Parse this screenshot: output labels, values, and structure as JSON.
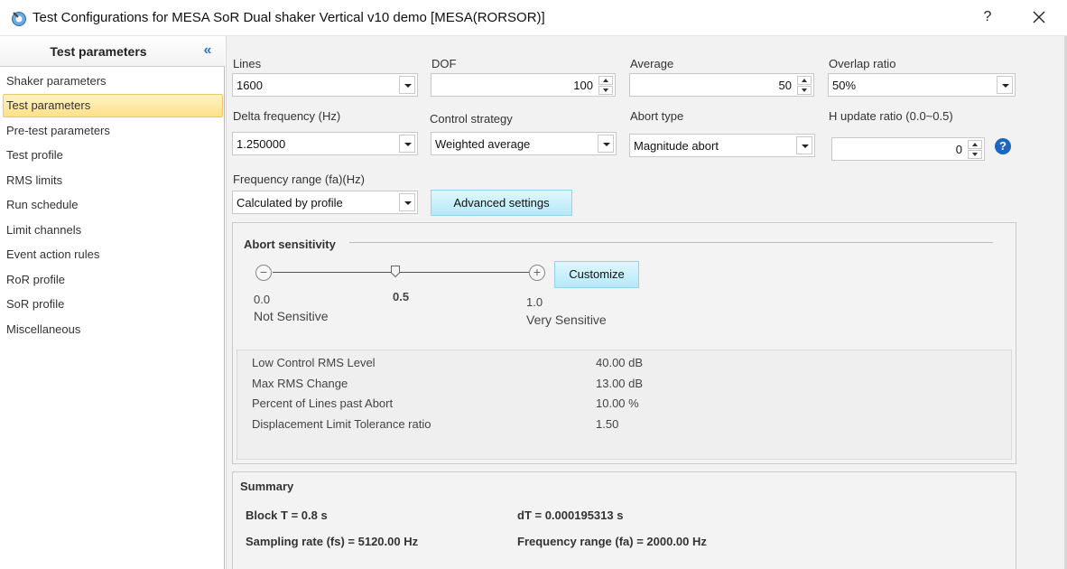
{
  "window": {
    "title": "Test Configurations for MESA SoR Dual shaker Vertical v10 demo [MESA(RORSOR)]",
    "help_label": "?"
  },
  "sidebar": {
    "title": "Test parameters",
    "items": [
      {
        "label": "Shaker parameters"
      },
      {
        "label": "Test parameters",
        "selected": true
      },
      {
        "label": "Pre-test parameters"
      },
      {
        "label": "Test profile"
      },
      {
        "label": "RMS limits"
      },
      {
        "label": "Run schedule"
      },
      {
        "label": "Limit channels"
      },
      {
        "label": "Event action rules"
      },
      {
        "label": "RoR profile"
      },
      {
        "label": "SoR profile"
      },
      {
        "label": "Miscellaneous"
      }
    ]
  },
  "params": {
    "lines": {
      "label": "Lines",
      "value": "1600"
    },
    "dof": {
      "label": "DOF",
      "value": "100"
    },
    "average": {
      "label": "Average",
      "value": "50"
    },
    "overlap": {
      "label": "Overlap ratio",
      "value": "50%"
    },
    "delta_freq": {
      "label": "Delta frequency (Hz)",
      "value": "1.250000"
    },
    "control_strategy": {
      "label": "Control strategy",
      "value": "Weighted average"
    },
    "abort_type": {
      "label": "Abort type",
      "value": "Magnitude abort"
    },
    "h_update": {
      "label": "H update ratio (0.0~0.5)",
      "value": "0"
    },
    "freq_range": {
      "label": "Frequency range (fa)(Hz)",
      "value": "Calculated by profile"
    },
    "advanced_settings": "Advanced settings"
  },
  "abort": {
    "title": "Abort sensitivity",
    "min_value": "0.0",
    "min_text": "Not Sensitive",
    "current_value": "0.5",
    "current_fraction": 0.5,
    "max_value": "1.0",
    "max_text": "Very Sensitive",
    "customize": "Customize",
    "metrics": [
      {
        "label": "Low Control RMS Level",
        "value": "40.00 dB"
      },
      {
        "label": "Max RMS Change",
        "value": "13.00 dB"
      },
      {
        "label": "Percent of Lines past Abort",
        "value": "10.00 %"
      },
      {
        "label": "Displacement Limit Tolerance ratio",
        "value": "1.50"
      }
    ]
  },
  "summary": {
    "title": "Summary",
    "block_t": "Block T = 0.8 s",
    "dt": "dT = 0.000195313 s",
    "sampling_rate": "Sampling rate (fs) = 5120.00 Hz",
    "frequency_range": "Frequency range (fa) = 2000.00 Hz"
  },
  "colors": {
    "accent_blue": "#2a74c9",
    "selected_bg": "#ffe08a",
    "button_cyan": "#b6e9f8"
  }
}
